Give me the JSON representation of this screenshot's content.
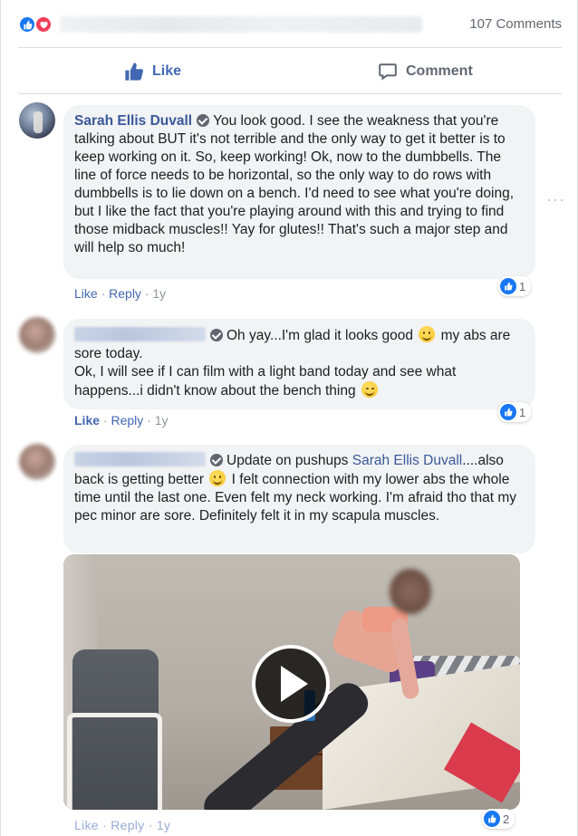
{
  "summary": {
    "comment_count": "107 Comments"
  },
  "actions": {
    "like_label": "Like",
    "comment_label": "Comment"
  },
  "colors": {
    "brand_blue": "#4267b2",
    "link_blue": "#385898",
    "like_reaction": "#1877f2",
    "love_reaction": "#f33e58",
    "bubble_bg": "#f2f3f5"
  },
  "icons": {
    "like": "thumbs-up-icon",
    "love": "heart-icon",
    "comment": "speech-bubble-icon",
    "verified": "verified-badge-icon",
    "more": "more-options-icon",
    "play": "play-icon"
  },
  "comments": [
    {
      "author": "Sarah Ellis Duvall",
      "text": "You look good. I see the weakness that you're talking about BUT it's not terrible and the only way to get it better is to keep working on it. So, keep working! Ok, now to the dumbbells. The line of force needs to be horizontal, so the only way to do rows with dumbbells is to lie down on a bench. I'd need to see what you're doing, but I like the fact that you're playing around with this and trying to find those midback muscles!! Yay for glutes!! That's such a major step and will help so much!",
      "like_link": "Like",
      "reply_link": "Reply",
      "time": "1y",
      "reaction_count": "1"
    },
    {
      "text_1": "Oh yay...I'm glad it looks good",
      "text_2": "my abs are sore today.",
      "text_3": "Ok, I will see if I can film with a light band today and see what happens...i didn't know about the bench thing",
      "like_link": "Like",
      "reply_link": "Reply",
      "time": "1y",
      "reaction_count": "1"
    },
    {
      "text_1": "Update on pushups",
      "mention": "Sarah Ellis Duvall",
      "text_2": "....also back is getting better",
      "text_3": "I felt connection with my lower abs the whole time until the last one. Even felt my neck working. I'm afraid tho that my pec minor are sore. Definitely felt it in my scapula muscles.",
      "reaction_count": "2",
      "cut_meta": "Like · Reply · 1y"
    }
  ],
  "separator": " · "
}
